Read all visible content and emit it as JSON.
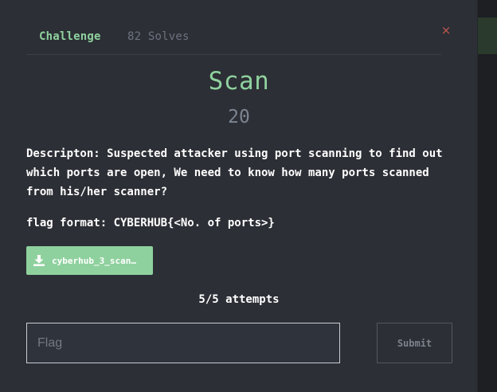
{
  "tabs": {
    "challenge": "Challenge",
    "solves": "82 Solves"
  },
  "close_symbol": "×",
  "challenge": {
    "name": "Scan",
    "points": "20",
    "description": "Descripton: Suspected attacker using port scanning to find out which ports are open, We need to know how many ports scanned from his/her scanner?",
    "flag_format": "flag format: CYBERHUB{<No. of ports>}"
  },
  "file": {
    "icon": "download-icon",
    "name": "cyberhub_3_scan…"
  },
  "attempts": "5/5 attempts",
  "flag_input": {
    "placeholder": "Flag",
    "value": ""
  },
  "submit_label": "Submit",
  "colors": {
    "accent": "#8fd19e",
    "close": "#c0564f",
    "modal_bg": "#2c2f35"
  }
}
